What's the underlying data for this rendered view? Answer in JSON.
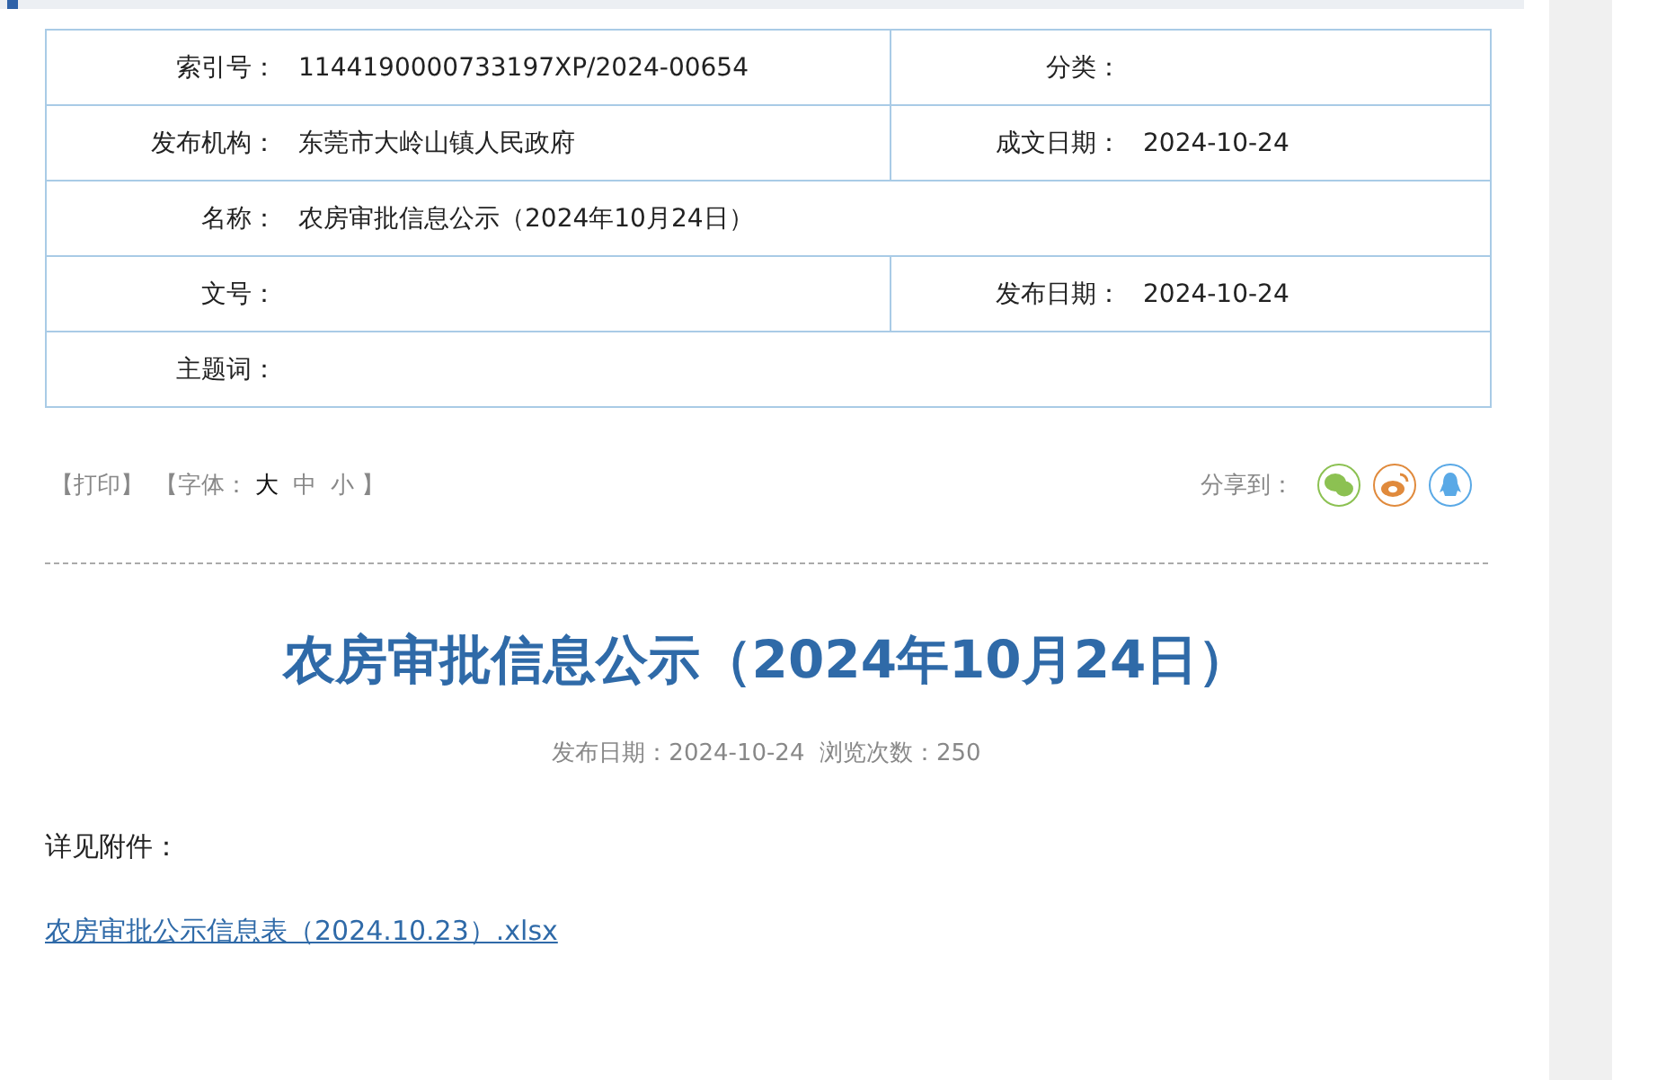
{
  "meta_table": {
    "rows": [
      {
        "cells": [
          {
            "label": "索引号：",
            "value": "1144190000733197XP/2024-00654"
          },
          {
            "label": "分类："
          }
        ]
      },
      {
        "cells": [
          {
            "label": "发布机构：",
            "value": "东莞市大岭山镇人民政府"
          },
          {
            "label": "成文日期：",
            "value": "2024-10-24"
          }
        ]
      },
      {
        "cells": [
          {
            "label": "名称：",
            "value": "农房审批信息公示（2024年10月24日）"
          }
        ]
      },
      {
        "cells": [
          {
            "label": "文号："
          },
          {
            "label": "发布日期：",
            "value": "2024-10-24"
          }
        ]
      },
      {
        "cells": [
          {
            "label": "主题词："
          }
        ]
      }
    ]
  },
  "tools": {
    "print": "【打印】",
    "font_label": "【字体：",
    "font_sizes": [
      {
        "label": "大",
        "selected": true
      },
      {
        "label": "中",
        "selected": false
      },
      {
        "label": "小",
        "selected": false
      }
    ],
    "font_end": "】"
  },
  "share": {
    "label": "分享到：",
    "targets": [
      {
        "kind": "wechat",
        "color": "#8cc152"
      },
      {
        "kind": "weibo",
        "color": "#e08a3c"
      },
      {
        "kind": "qq",
        "color": "#5aa9e6"
      }
    ]
  },
  "article": {
    "title": "农房审批信息公示（2024年10月24日）",
    "info": "发布日期：2024-10-24  浏览次数：250",
    "body": "详见附件：",
    "attachment": "农房审批公示信息表（2024.10.23）.xlsx"
  }
}
